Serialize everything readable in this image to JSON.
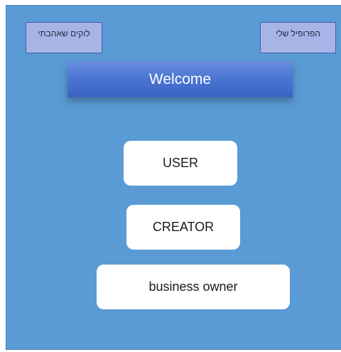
{
  "header": {
    "liked_places_label": "לוקים שאהבתי",
    "my_profile_label": "הפרופיל שלי"
  },
  "welcome": {
    "title": "Welcome"
  },
  "roles": {
    "user_label": "USER",
    "creator_label": "CREATOR",
    "business_owner_label": "business owner"
  },
  "colors": {
    "background": "#5a9bd5",
    "top_button_fill": "#a7b5e6",
    "welcome_banner": "#4a74d3",
    "role_button_fill": "#ffffff"
  }
}
